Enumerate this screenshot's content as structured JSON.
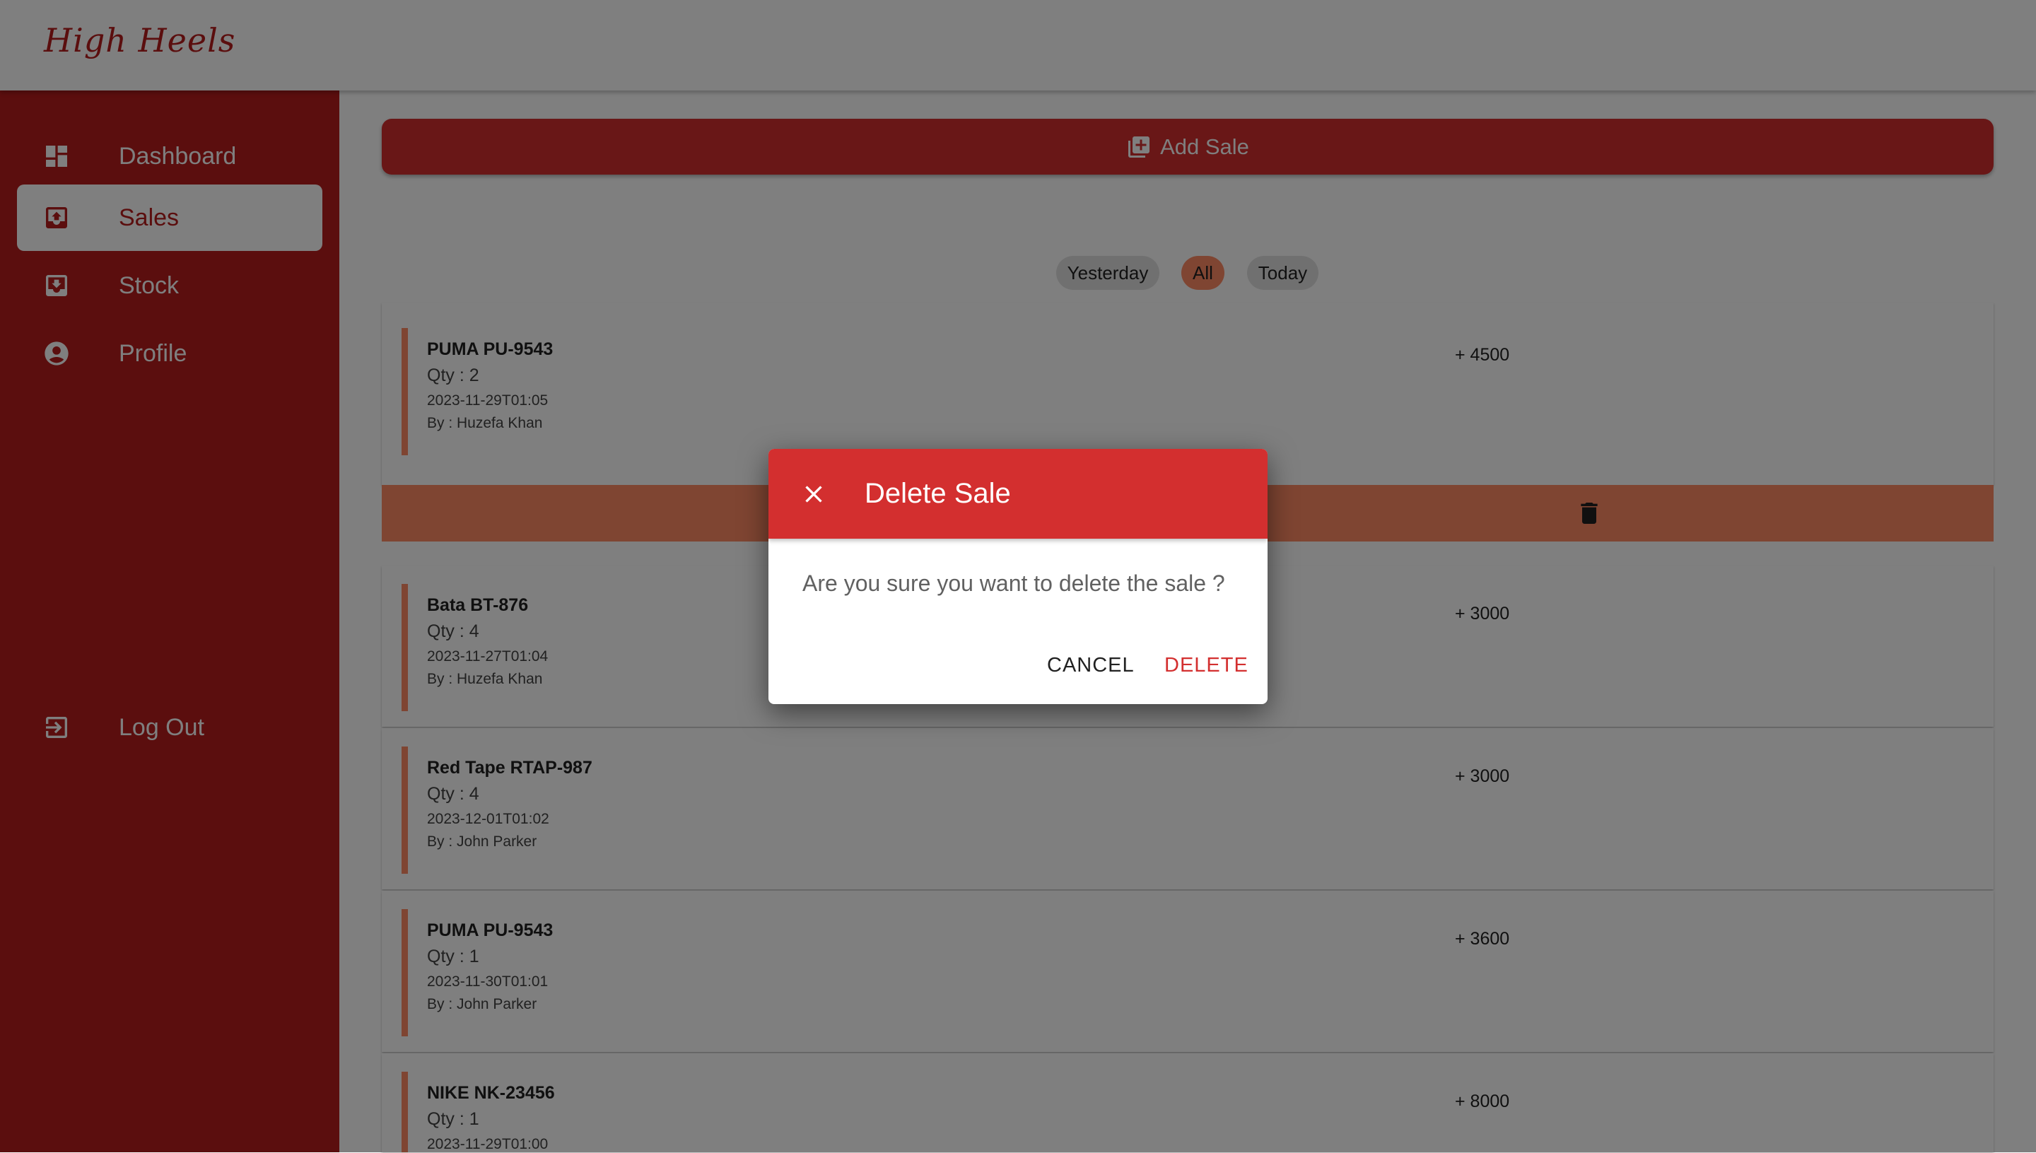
{
  "app": {
    "logo": "High Heels"
  },
  "sidebar": {
    "items": [
      {
        "label": "Dashboard",
        "icon": "dashboard-icon",
        "active": false
      },
      {
        "label": "Sales",
        "icon": "sales-icon",
        "active": true
      },
      {
        "label": "Stock",
        "icon": "stock-icon",
        "active": false
      },
      {
        "label": "Profile",
        "icon": "profile-icon",
        "active": false
      }
    ],
    "logout": {
      "label": "Log Out",
      "icon": "logout-icon"
    }
  },
  "main": {
    "add_sale_label": "Add Sale",
    "filters": [
      "Yesterday",
      "All",
      "Today"
    ],
    "active_filter": "All",
    "sales": [
      {
        "product": "PUMA PU-9543",
        "qty": "Qty : 2",
        "date": "2023-11-29T01:05",
        "by": "By : Huzefa Khan",
        "amount": "+ 4500"
      },
      {
        "product": "Bata BT-876",
        "qty": "Qty : 4",
        "date": "2023-11-27T01:04",
        "by": "By : Huzefa Khan",
        "amount": "+ 3000"
      },
      {
        "product": "Red Tape RTAP-987",
        "qty": "Qty : 4",
        "date": "2023-12-01T01:02",
        "by": "By : John Parker",
        "amount": "+ 3000"
      },
      {
        "product": "PUMA PU-9543",
        "qty": "Qty : 1",
        "date": "2023-11-30T01:01",
        "by": "By : John Parker",
        "amount": "+ 3600"
      },
      {
        "product": "NIKE NK-23456",
        "qty": "Qty : 1",
        "date": "2023-11-29T01:00",
        "by": "",
        "amount": "+ 8000"
      }
    ]
  },
  "dialog": {
    "title": "Delete Sale",
    "message": "Are you sure you want to delete the sale ?",
    "cancel_label": "CANCEL",
    "delete_label": "DELETE"
  },
  "colors": {
    "primary": "#b71c1c",
    "dialog_header": "#d32f2f",
    "accent": "#ff8a65"
  }
}
